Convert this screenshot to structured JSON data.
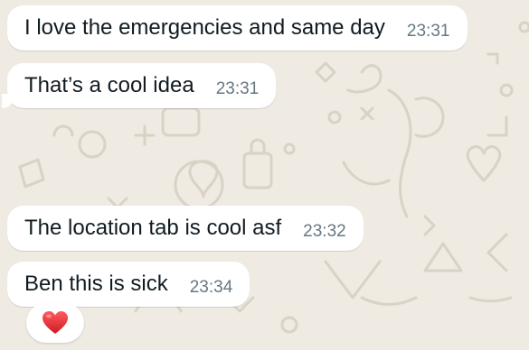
{
  "messages": [
    {
      "text": "I love the emergencies and same day",
      "time": "23:31"
    },
    {
      "text": "That’s a cool idea",
      "time": "23:31"
    },
    {
      "text": "The location tab is cool asf",
      "time": "23:32"
    },
    {
      "text": "Ben this is sick",
      "time": "23:34"
    }
  ],
  "reaction": {
    "emoji": "heart",
    "color": "#e0252b"
  },
  "colors": {
    "background": "#efeae2",
    "bubble": "#ffffff",
    "text": "#111b21",
    "timestamp": "#667781"
  }
}
